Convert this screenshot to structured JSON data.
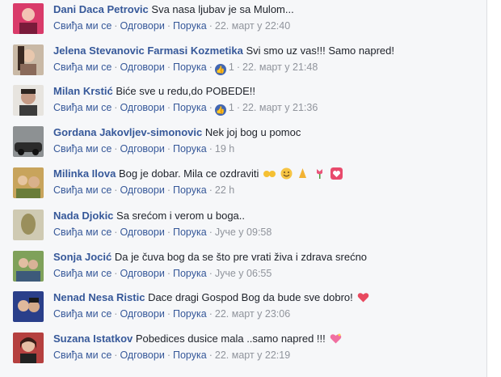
{
  "actions": {
    "like": "Свиђа ми се",
    "reply": "Одговори",
    "message": "Порука"
  },
  "comments": [
    {
      "author": "Dani Daca Petrovic",
      "text": "Sva nasa ljubav je sa Mulom...",
      "time": "22. март у 22:40",
      "likes": ""
    },
    {
      "author": "Jelena Stevanovic Farmasi Kozmetika",
      "text": "Svi smo uz vas!!! Samo napred!",
      "time": "22. март у 21:48",
      "likes": "1"
    },
    {
      "author": "Milan Krstić",
      "text": "Biće sve u redu,do POBEDE!!",
      "time": "22. март у 21:36",
      "likes": "1"
    },
    {
      "author": "Gordana Jakovljev-simonovic",
      "text": "Nek joj bog u pomoc",
      "time": "19 h",
      "likes": ""
    },
    {
      "author": "Milinka Ilova",
      "text": "Bog je dobar. Mila ce ozdraviti",
      "time": "22 h",
      "likes": "",
      "emojis": [
        "raising-hands",
        "smiling-face",
        "praying-hands",
        "tulip",
        "heart-box"
      ]
    },
    {
      "author": "Nada Djokic",
      "text": "Sa srećom i verom u boga..",
      "time": "Јуче у 09:58",
      "likes": ""
    },
    {
      "author": "Sonja Jocić",
      "text": "Da je čuva bog da se što pre vrati živa i zdrava srećno",
      "time": "Јуче у 06:55",
      "likes": ""
    },
    {
      "author": "Nenad Nesa Ristic",
      "text": "Dace dragi Gospod Bog da bude sve dobro!",
      "time": "22. март у 23:06",
      "likes": "",
      "emojis": [
        "red-heart"
      ]
    },
    {
      "author": "Suzana Istatkov",
      "text": "Pobedices dusice mala ..samo napred !!!",
      "time": "22. март у 22:19",
      "likes": "",
      "emojis": [
        "sparkling-heart"
      ]
    }
  ],
  "colors": {
    "link": "#365899",
    "meta": "#90949c",
    "text": "#1d2129",
    "like_badge": "#4267b2"
  }
}
